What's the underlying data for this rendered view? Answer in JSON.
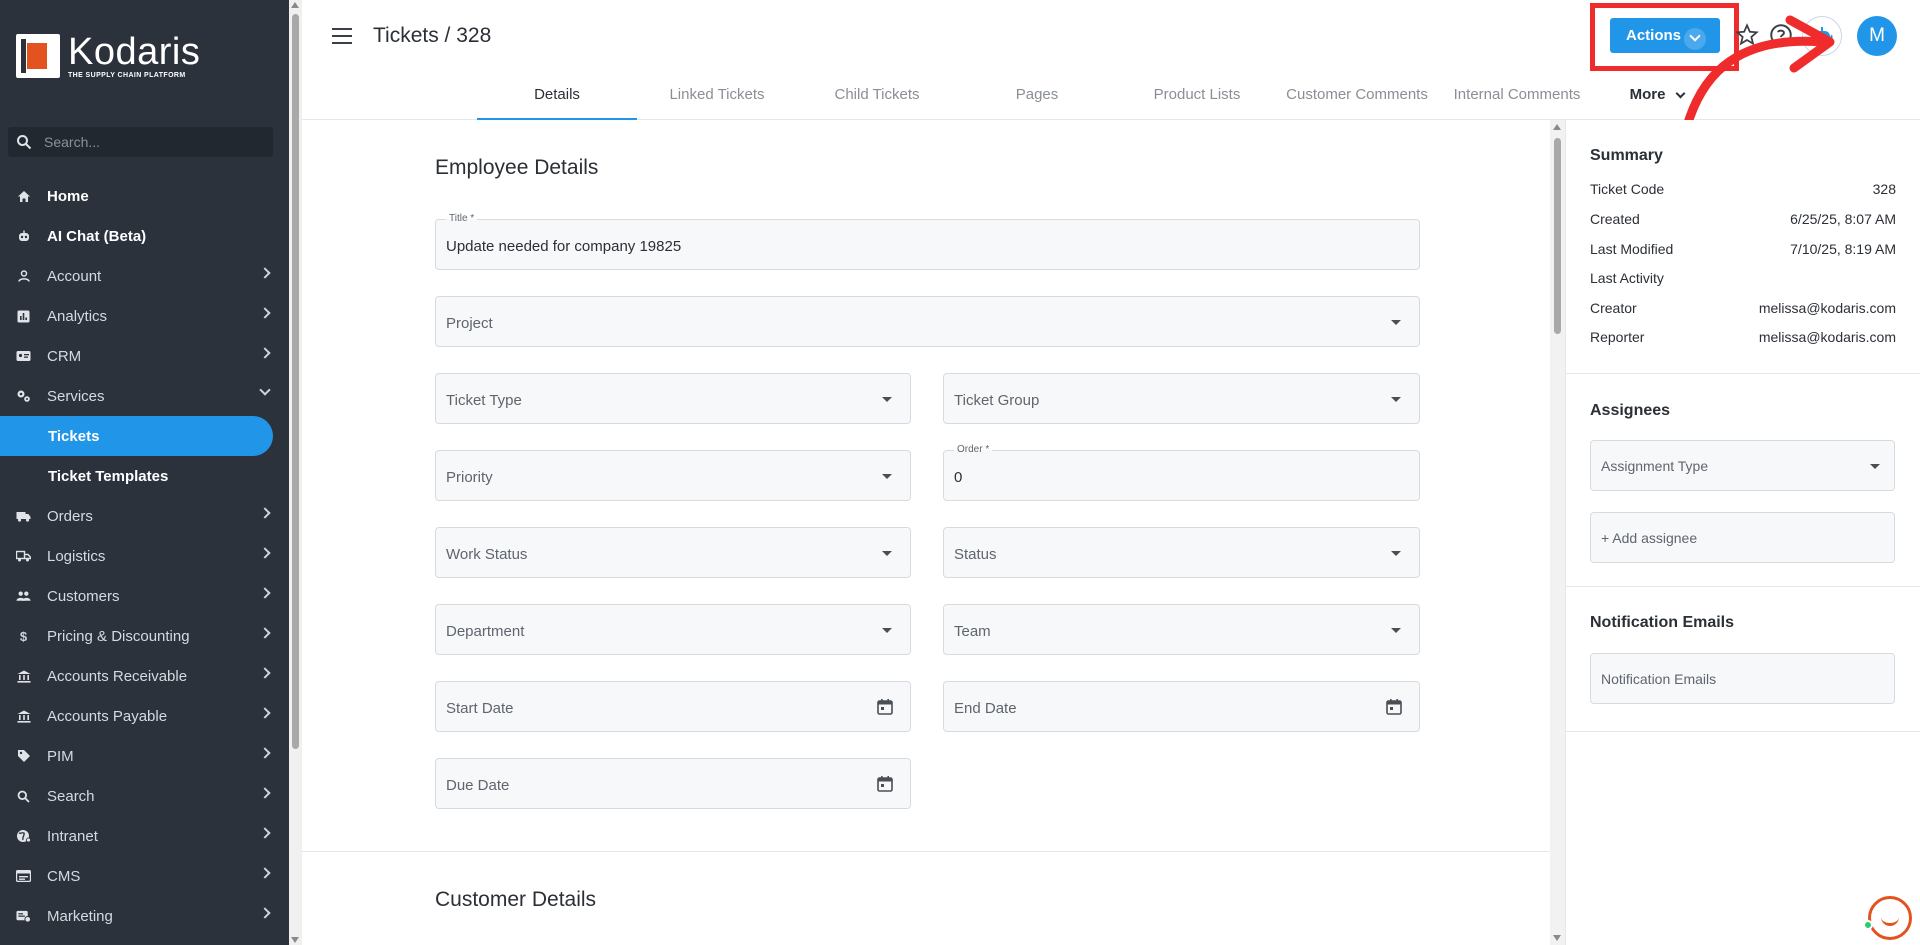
{
  "brand": {
    "name": "Kodaris",
    "tagline": "THE SUPPLY CHAIN PLATFORM",
    "accent": "#2196e8",
    "logo_orange": "#e2531f"
  },
  "sidebar": {
    "search_placeholder": "Search...",
    "items": [
      {
        "label": "Home",
        "icon": "home-icon"
      },
      {
        "label": "AI Chat (Beta)",
        "icon": "robot-icon"
      },
      {
        "label": "Account",
        "icon": "person-icon"
      },
      {
        "label": "Analytics",
        "icon": "chart-icon"
      },
      {
        "label": "CRM",
        "icon": "id-card-icon"
      },
      {
        "label": "Services",
        "icon": "gears-icon"
      },
      {
        "label": "Tickets",
        "icon": ""
      },
      {
        "label": "Ticket Templates",
        "icon": ""
      },
      {
        "label": "Orders",
        "icon": "truck-icon"
      },
      {
        "label": "Logistics",
        "icon": "shipping-icon"
      },
      {
        "label": "Customers",
        "icon": "people-icon"
      },
      {
        "label": "Pricing & Discounting",
        "icon": "dollar-icon"
      },
      {
        "label": "Accounts Receivable",
        "icon": "bank-icon"
      },
      {
        "label": "Accounts Payable",
        "icon": "bank-icon"
      },
      {
        "label": "PIM",
        "icon": "tag-icon"
      },
      {
        "label": "Search",
        "icon": "search-icon"
      },
      {
        "label": "Intranet",
        "icon": "globe-icon"
      },
      {
        "label": "CMS",
        "icon": "cms-icon"
      },
      {
        "label": "Marketing",
        "icon": "megaphone-icon"
      }
    ]
  },
  "header": {
    "title": "Tickets / 328",
    "actions_label": "Actions",
    "avatar_initial": "M",
    "tabs": [
      "Details",
      "Linked Tickets",
      "Child Tickets",
      "Pages",
      "Product Lists",
      "Customer Comments",
      "Internal Comments"
    ],
    "more_label": "More"
  },
  "form": {
    "section_employee": "Employee Details",
    "section_customer": "Customer Details",
    "title_label": "Title *",
    "title_value": "Update needed for company 19825",
    "project": "Project",
    "ticket_type": "Ticket Type",
    "ticket_group": "Ticket Group",
    "priority": "Priority",
    "order_label": "Order *",
    "order_value": "0",
    "work_status": "Work Status",
    "status": "Status",
    "department": "Department",
    "team": "Team",
    "start_date": "Start Date",
    "end_date": "End Date",
    "due_date": "Due Date"
  },
  "summary": {
    "title": "Summary",
    "rows": [
      {
        "label": "Ticket Code",
        "value": "328"
      },
      {
        "label": "Created",
        "value": "6/25/25, 8:07 AM"
      },
      {
        "label": "Last Modified",
        "value": "7/10/25, 8:19 AM"
      },
      {
        "label": "Last Activity",
        "value": ""
      },
      {
        "label": "Creator",
        "value": "melissa@kodaris.com"
      },
      {
        "label": "Reporter",
        "value": "melissa@kodaris.com"
      }
    ]
  },
  "assignees": {
    "title": "Assignees",
    "assignment_type": "Assignment Type",
    "add_assignee": "+ Add assignee"
  },
  "notifications": {
    "title": "Notification Emails",
    "placeholder": "Notification Emails"
  }
}
